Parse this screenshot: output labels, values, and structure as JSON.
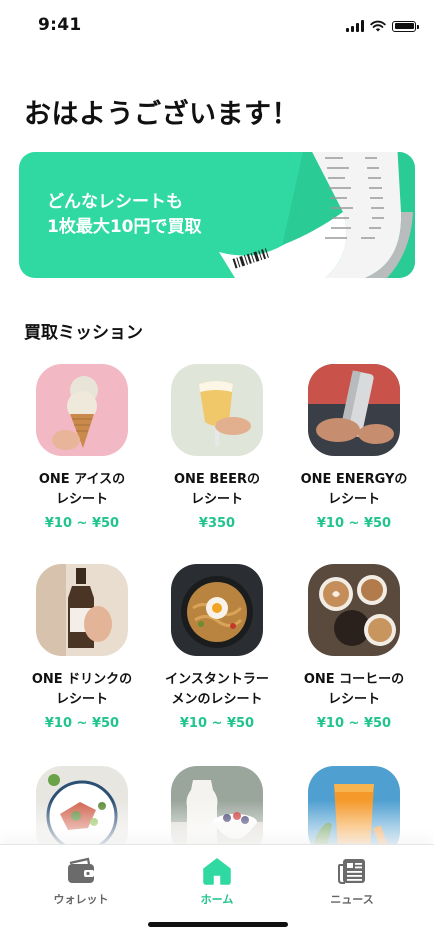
{
  "status_bar": {
    "time": "9:41"
  },
  "header": {
    "greeting": "おはようございます！"
  },
  "banner": {
    "line1": "どんなレシートも",
    "line2": "1枚最大10円で買取"
  },
  "missions": {
    "title": "買取ミッション",
    "items": [
      {
        "title_line1": "ONE アイスの",
        "title_line2": "レシート",
        "price": "¥10 ~ ¥50",
        "image": "ice-cream-cone-photo"
      },
      {
        "title_line1": "ONE BEERの",
        "title_line2": "レシート",
        "price": "¥350",
        "image": "beer-glass-photo"
      },
      {
        "title_line1": "ONE ENERGYの",
        "title_line2": "レシート",
        "price": "¥10 ~ ¥50",
        "image": "energy-drink-can-photo"
      },
      {
        "title_line1": "ONE ドリンクの",
        "title_line2": "レシート",
        "price": "¥10 ~ ¥50",
        "image": "drink-bottle-photo"
      },
      {
        "title_line1": "インスタントラー",
        "title_line2": "メンのレシート",
        "price": "¥10 ~ ¥50",
        "image": "instant-ramen-photo"
      },
      {
        "title_line1": "ONE コーヒーの",
        "title_line2": "レシート",
        "price": "¥10 ~ ¥50",
        "image": "coffee-cups-photo"
      },
      {
        "title_line1": "",
        "title_line2": "",
        "price": "",
        "image": "salad-plate-photo"
      },
      {
        "title_line1": "",
        "title_line2": "",
        "price": "",
        "image": "milk-and-berries-photo"
      },
      {
        "title_line1": "",
        "title_line2": "",
        "price": "",
        "image": "orange-juice-photo"
      }
    ]
  },
  "tab_bar": {
    "tabs": [
      {
        "label": "ウォレット",
        "icon": "wallet-icon",
        "active": false
      },
      {
        "label": "ホーム",
        "icon": "home-icon",
        "active": true
      },
      {
        "label": "ニュース",
        "icon": "news-icon",
        "active": false
      }
    ]
  },
  "colors": {
    "accent": "#2fd9a1",
    "price": "#21c48c",
    "tab_inactive": "#666666"
  }
}
